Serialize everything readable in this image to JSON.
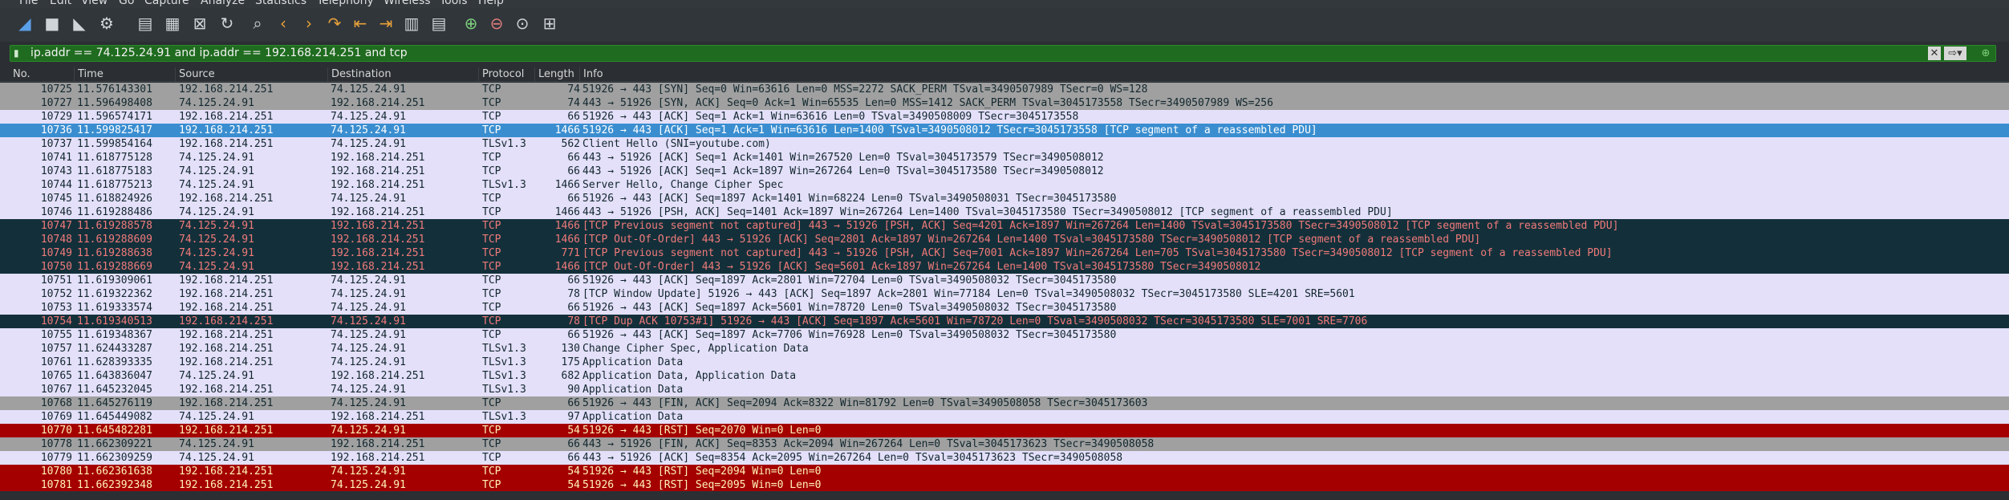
{
  "menu": [
    "File",
    "Edit",
    "View",
    "Go",
    "Capture",
    "Analyze",
    "Statistics",
    "Telephony",
    "Wireless",
    "Tools",
    "Help"
  ],
  "filter": {
    "text": "ip.addr == 74.125.24.91 and ip.addr == 192.168.214.251 and tcp"
  },
  "columns": {
    "no": "No.",
    "time": "Time",
    "source": "Source",
    "destination": "Destination",
    "protocol": "Protocol",
    "length": "Length",
    "info": "Info"
  },
  "packets": [
    {
      "no": "10725",
      "time": "11.576143301",
      "src": "192.168.214.251",
      "dst": "74.125.24.91",
      "proto": "TCP",
      "len": "74",
      "info": "51926 → 443 [SYN] Seq=0 Win=63616 Len=0 MSS=2272 SACK_PERM TSval=3490507989 TSecr=0 WS=128",
      "style": "gray"
    },
    {
      "no": "10727",
      "time": "11.596498408",
      "src": "74.125.24.91",
      "dst": "192.168.214.251",
      "proto": "TCP",
      "len": "74",
      "info": "443 → 51926 [SYN, ACK] Seq=0 Ack=1 Win=65535 Len=0 MSS=1412 SACK_PERM TSval=3045173558 TSecr=3490507989 WS=256",
      "style": "gray"
    },
    {
      "no": "10729",
      "time": "11.596574171",
      "src": "192.168.214.251",
      "dst": "74.125.24.91",
      "proto": "TCP",
      "len": "66",
      "info": "51926 → 443 [ACK] Seq=1 Ack=1 Win=63616 Len=0 TSval=3490508009 TSecr=3045173558",
      "style": "lav"
    },
    {
      "no": "10736",
      "time": "11.599825417",
      "src": "192.168.214.251",
      "dst": "74.125.24.91",
      "proto": "TCP",
      "len": "1466",
      "info": "51926 → 443 [ACK] Seq=1 Ack=1 Win=63616 Len=1400 TSval=3490508012 TSecr=3045173558 [TCP segment of a reassembled PDU]",
      "style": "sel"
    },
    {
      "no": "10737",
      "time": "11.599854164",
      "src": "192.168.214.251",
      "dst": "74.125.24.91",
      "proto": "TLSv1.3",
      "len": "562",
      "info": "Client Hello (SNI=youtube.com)",
      "style": "lav"
    },
    {
      "no": "10741",
      "time": "11.618775128",
      "src": "74.125.24.91",
      "dst": "192.168.214.251",
      "proto": "TCP",
      "len": "66",
      "info": "443 → 51926 [ACK] Seq=1 Ack=1401 Win=267520 Len=0 TSval=3045173579 TSecr=3490508012",
      "style": "lav"
    },
    {
      "no": "10743",
      "time": "11.618775183",
      "src": "74.125.24.91",
      "dst": "192.168.214.251",
      "proto": "TCP",
      "len": "66",
      "info": "443 → 51926 [ACK] Seq=1 Ack=1897 Win=267264 Len=0 TSval=3045173580 TSecr=3490508012",
      "style": "lav"
    },
    {
      "no": "10744",
      "time": "11.618775213",
      "src": "74.125.24.91",
      "dst": "192.168.214.251",
      "proto": "TLSv1.3",
      "len": "1466",
      "info": "Server Hello, Change Cipher Spec",
      "style": "lav"
    },
    {
      "no": "10745",
      "time": "11.618824926",
      "src": "192.168.214.251",
      "dst": "74.125.24.91",
      "proto": "TCP",
      "len": "66",
      "info": "51926 → 443 [ACK] Seq=1897 Ack=1401 Win=68224 Len=0 TSval=3490508031 TSecr=3045173580",
      "style": "lav"
    },
    {
      "no": "10746",
      "time": "11.619288486",
      "src": "74.125.24.91",
      "dst": "192.168.214.251",
      "proto": "TCP",
      "len": "1466",
      "info": "443 → 51926 [PSH, ACK] Seq=1401 Ack=1897 Win=267264 Len=1400 TSval=3045173580 TSecr=3490508012 [TCP segment of a reassembled PDU]",
      "style": "lav"
    },
    {
      "no": "10747",
      "time": "11.619288578",
      "src": "74.125.24.91",
      "dst": "192.168.214.251",
      "proto": "TCP",
      "len": "1466",
      "info": "[TCP Previous segment not captured] 443 → 51926 [PSH, ACK] Seq=4201 Ack=1897 Win=267264 Len=1400 TSval=3045173580 TSecr=3490508012 [TCP segment of a reassembled PDU]",
      "style": "dark"
    },
    {
      "no": "10748",
      "time": "11.619288609",
      "src": "74.125.24.91",
      "dst": "192.168.214.251",
      "proto": "TCP",
      "len": "1466",
      "info": "[TCP Out-Of-Order] 443 → 51926 [ACK] Seq=2801 Ack=1897 Win=267264 Len=1400 TSval=3045173580 TSecr=3490508012 [TCP segment of a reassembled PDU]",
      "style": "dark"
    },
    {
      "no": "10749",
      "time": "11.619288638",
      "src": "74.125.24.91",
      "dst": "192.168.214.251",
      "proto": "TCP",
      "len": "771",
      "info": "[TCP Previous segment not captured] 443 → 51926 [PSH, ACK] Seq=7001 Ack=1897 Win=267264 Len=705 TSval=3045173580 TSecr=3490508012 [TCP segment of a reassembled PDU]",
      "style": "dark"
    },
    {
      "no": "10750",
      "time": "11.619288669",
      "src": "74.125.24.91",
      "dst": "192.168.214.251",
      "proto": "TCP",
      "len": "1466",
      "info": "[TCP Out-Of-Order] 443 → 51926 [ACK] Seq=5601 Ack=1897 Win=267264 Len=1400 TSval=3045173580 TSecr=3490508012",
      "style": "dark"
    },
    {
      "no": "10751",
      "time": "11.619309061",
      "src": "192.168.214.251",
      "dst": "74.125.24.91",
      "proto": "TCP",
      "len": "66",
      "info": "51926 → 443 [ACK] Seq=1897 Ack=2801 Win=72704 Len=0 TSval=3490508032 TSecr=3045173580",
      "style": "lav"
    },
    {
      "no": "10752",
      "time": "11.619322362",
      "src": "192.168.214.251",
      "dst": "74.125.24.91",
      "proto": "TCP",
      "len": "78",
      "info": "[TCP Window Update] 51926 → 443 [ACK] Seq=1897 Ack=2801 Win=77184 Len=0 TSval=3490508032 TSecr=3045173580 SLE=4201 SRE=5601",
      "style": "lav"
    },
    {
      "no": "10753",
      "time": "11.619333574",
      "src": "192.168.214.251",
      "dst": "74.125.24.91",
      "proto": "TCP",
      "len": "66",
      "info": "51926 → 443 [ACK] Seq=1897 Ack=5601 Win=78720 Len=0 TSval=3490508032 TSecr=3045173580",
      "style": "lav"
    },
    {
      "no": "10754",
      "time": "11.619340513",
      "src": "192.168.214.251",
      "dst": "74.125.24.91",
      "proto": "TCP",
      "len": "78",
      "info": "[TCP Dup ACK 10753#1] 51926 → 443 [ACK] Seq=1897 Ack=5601 Win=78720 Len=0 TSval=3490508032 TSecr=3045173580 SLE=7001 SRE=7706",
      "style": "dark"
    },
    {
      "no": "10755",
      "time": "11.619348367",
      "src": "192.168.214.251",
      "dst": "74.125.24.91",
      "proto": "TCP",
      "len": "66",
      "info": "51926 → 443 [ACK] Seq=1897 Ack=7706 Win=76928 Len=0 TSval=3490508032 TSecr=3045173580",
      "style": "lav"
    },
    {
      "no": "10757",
      "time": "11.624433287",
      "src": "192.168.214.251",
      "dst": "74.125.24.91",
      "proto": "TLSv1.3",
      "len": "130",
      "info": "Change Cipher Spec, Application Data",
      "style": "lav"
    },
    {
      "no": "10761",
      "time": "11.628393335",
      "src": "192.168.214.251",
      "dst": "74.125.24.91",
      "proto": "TLSv1.3",
      "len": "175",
      "info": "Application Data",
      "style": "lav"
    },
    {
      "no": "10765",
      "time": "11.643836047",
      "src": "74.125.24.91",
      "dst": "192.168.214.251",
      "proto": "TLSv1.3",
      "len": "682",
      "info": "Application Data, Application Data",
      "style": "lav"
    },
    {
      "no": "10767",
      "time": "11.645232045",
      "src": "192.168.214.251",
      "dst": "74.125.24.91",
      "proto": "TLSv1.3",
      "len": "90",
      "info": "Application Data",
      "style": "lav"
    },
    {
      "no": "10768",
      "time": "11.645276119",
      "src": "192.168.214.251",
      "dst": "74.125.24.91",
      "proto": "TCP",
      "len": "66",
      "info": "51926 → 443 [FIN, ACK] Seq=2094 Ack=8322 Win=81792 Len=0 TSval=3490508058 TSecr=3045173603",
      "style": "gray"
    },
    {
      "no": "10769",
      "time": "11.645449082",
      "src": "74.125.24.91",
      "dst": "192.168.214.251",
      "proto": "TLSv1.3",
      "len": "97",
      "info": "Application Data",
      "style": "lav"
    },
    {
      "no": "10770",
      "time": "11.645482281",
      "src": "192.168.214.251",
      "dst": "74.125.24.91",
      "proto": "TCP",
      "len": "54",
      "info": "51926 → 443 [RST] Seq=2070 Win=0 Len=0",
      "style": "red"
    },
    {
      "no": "10778",
      "time": "11.662309221",
      "src": "74.125.24.91",
      "dst": "192.168.214.251",
      "proto": "TCP",
      "len": "66",
      "info": "443 → 51926 [FIN, ACK] Seq=8353 Ack=2094 Win=267264 Len=0 TSval=3045173623 TSecr=3490508058",
      "style": "gray"
    },
    {
      "no": "10779",
      "time": "11.662309259",
      "src": "74.125.24.91",
      "dst": "192.168.214.251",
      "proto": "TCP",
      "len": "66",
      "info": "443 → 51926 [ACK] Seq=8354 Ack=2095 Win=267264 Len=0 TSval=3045173623 TSecr=3490508058",
      "style": "lav"
    },
    {
      "no": "10780",
      "time": "11.662361638",
      "src": "192.168.214.251",
      "dst": "74.125.24.91",
      "proto": "TCP",
      "len": "54",
      "info": "51926 → 443 [RST] Seq=2094 Win=0 Len=0",
      "style": "red"
    },
    {
      "no": "10781",
      "time": "11.662392348",
      "src": "192.168.214.251",
      "dst": "74.125.24.91",
      "proto": "TCP",
      "len": "54",
      "info": "51926 → 443 [RST] Seq=2095 Win=0 Len=0",
      "style": "red"
    }
  ]
}
